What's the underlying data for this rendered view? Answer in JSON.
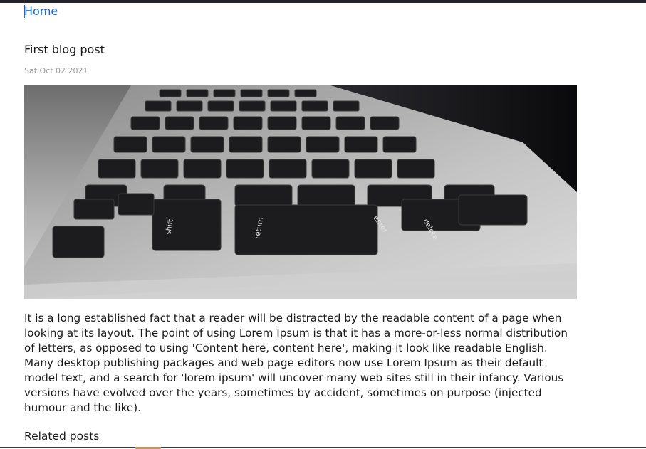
{
  "nav": {
    "home_label": "Home"
  },
  "post": {
    "title": "First blog post",
    "date": "Sat Oct 02 2021",
    "image_icon": "laptop-keyboard-photo",
    "body": "It is a long established fact that a reader will be distracted by the readable content of a page when looking at its layout. The point of using Lorem Ipsum is that it has a more-or-less normal distribution of letters, as opposed to using 'Content here, content here', making it look like readable English. Many desktop publishing packages and web page editors now use Lorem Ipsum as their default model text, and a search for 'lorem ipsum' will uncover many web sites still in their infancy. Various versions have evolved over the years, sometimes by accident, sometimes on purpose (injected humour and the like)."
  },
  "related": {
    "heading": "Related posts"
  },
  "colors": {
    "link": "#1a6ad6",
    "text": "#1a1a1a",
    "date": "#9a9a9a",
    "top_bar": "#24242c"
  }
}
